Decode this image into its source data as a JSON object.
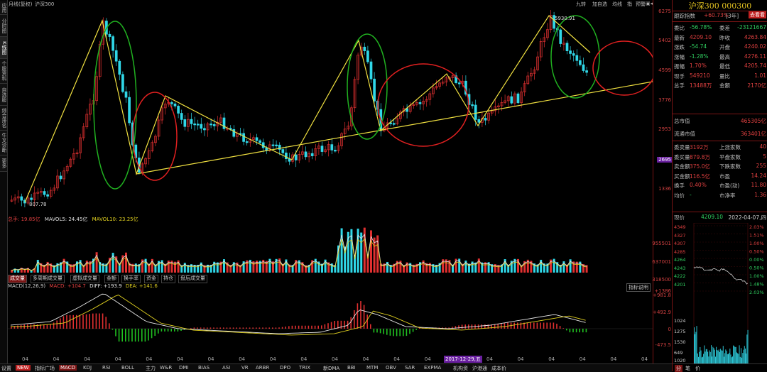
{
  "left_tabs": [
    "应用",
    "分时图",
    "K线图",
    "个股资料",
    "自选股",
    "综合排名",
    "牛叉诊断",
    "更多"
  ],
  "top_bar": {
    "period": "月线(复权)",
    "name": "沪深300",
    "buttons": [
      "九转",
      "加自选",
      "均线",
      "指",
      "预警"
    ]
  },
  "main": {
    "y_ticks": [
      "6275",
      "5402",
      "4599",
      "3776",
      "2953",
      "2695",
      "1336"
    ],
    "high_label": "5930.91",
    "low_label": "807.78",
    "current_tag": "2695"
  },
  "side": {
    "title": "沪深300 000300",
    "index_line": {
      "label": "跟踪指数",
      "value": "+60.73%",
      "period": "[3年]",
      "button": "去看看"
    },
    "rows": [
      {
        "l": "委比",
        "v": "-56.78%",
        "l2": "委差",
        "v2": "-23121667"
      },
      {
        "l": "最新",
        "v": "4209.10",
        "l2": "昨收",
        "v2": "4263.84"
      },
      {
        "l": "涨跌",
        "v": "-54.74",
        "l2": "开盘",
        "v2": "4240.02"
      },
      {
        "l": "涨幅",
        "v": "-1.28%",
        "l2": "最高",
        "v2": "4276.11"
      },
      {
        "l": "振幅",
        "v": "1.70%",
        "l2": "最低",
        "v2": "4205.74"
      },
      {
        "l": "现手",
        "v": "549210",
        "l2": "量比",
        "v2": "1.01"
      },
      {
        "l": "总手",
        "v": "13488万",
        "l2": "金额",
        "v2": "2170亿"
      }
    ],
    "mv_rows": [
      {
        "l": "总市值",
        "v": "465305亿"
      },
      {
        "l": "流通市值",
        "v": "363401亿"
      }
    ],
    "rows2": [
      {
        "l": "委卖量",
        "v": "3192万",
        "l2": "上涨家数",
        "v2": "40"
      },
      {
        "l": "委买量",
        "v": "879.8万",
        "l2": "平盘家数",
        "v2": "5"
      },
      {
        "l": "卖金额",
        "v": "375.0亿",
        "l2": "下跌家数",
        "v2": "255"
      },
      {
        "l": "买金额",
        "v": "116.5亿",
        "l2": "市盈",
        "v2": "14.24"
      },
      {
        "l": "换手",
        "v": "0.40%",
        "l2": "市盈(动)",
        "v2": "11.80"
      },
      {
        "l": "均价",
        "v": "-",
        "l2": "市净率",
        "v2": "1.36"
      }
    ],
    "current": {
      "label": "现价",
      "value": "4209.10",
      "date": "2022-04-07,四"
    },
    "mini_left": [
      "4349",
      "4327",
      "4307",
      "4285",
      "4264",
      "4243",
      "4222",
      "4201",
      "1024",
      "1275",
      "1530",
      "649",
      "1020"
    ],
    "mini_right": [
      "2.03%",
      "1.51%",
      "1.00%",
      "0.50%",
      "0.00%",
      "0.50%",
      "1.00%",
      "1.48%",
      "2.03%"
    ],
    "bottom_tabs": [
      "分",
      "笔",
      "价"
    ]
  },
  "vol": {
    "legend_label": "总手: 19.85亿",
    "ma5": "MAVOL5: 24.45亿",
    "ma10": "MAVOL10: 23.25亿",
    "y_ticks": [
      "955501",
      "637001",
      "318500"
    ]
  },
  "tabs": [
    "成交量",
    "多周期成交量",
    "虚拟成交量",
    "金额",
    "换手率",
    "资金",
    "持仓",
    "盘后成交量"
  ],
  "macd": {
    "name": "MACD(12,26,9)",
    "macd": "MACD: +104.7",
    "diff": "DIFF: +193.9",
    "dea": "DEA: +141.6",
    "button": "指标说明",
    "y_ticks": [
      "+1386",
      "+981.8",
      "+492.9",
      "0",
      "-473.5"
    ]
  },
  "x_ticks": [
    "04",
    "04",
    "04",
    "04",
    "04",
    "04",
    "04",
    "04",
    "04",
    "04",
    "04",
    "04",
    "04",
    "04",
    "04",
    "04",
    "04",
    "04",
    "04",
    "04",
    "04"
  ],
  "x_cursor": "2017-12-29,五",
  "bottom_bar": [
    "设置",
    "NEW",
    "指标广场",
    "MACD",
    "KDJ",
    "RSI",
    "BOLL",
    "主力",
    "W&R",
    "DMI",
    "BIAS",
    "ASI",
    "VR",
    "ARBR",
    "DPO",
    "TRIX",
    "新DMA",
    "BBI",
    "MTM",
    "OBV",
    "SAR",
    "EXPMA",
    "机构资",
    "沪港通",
    "成本价"
  ],
  "colors": {
    "up": "#e03030",
    "down": "#30d8e8",
    "trend": "#f0e040",
    "circle_red": "#e02020",
    "circle_green": "#20b020",
    "diff": "#e8e8e8",
    "dea": "#e0d020"
  }
}
